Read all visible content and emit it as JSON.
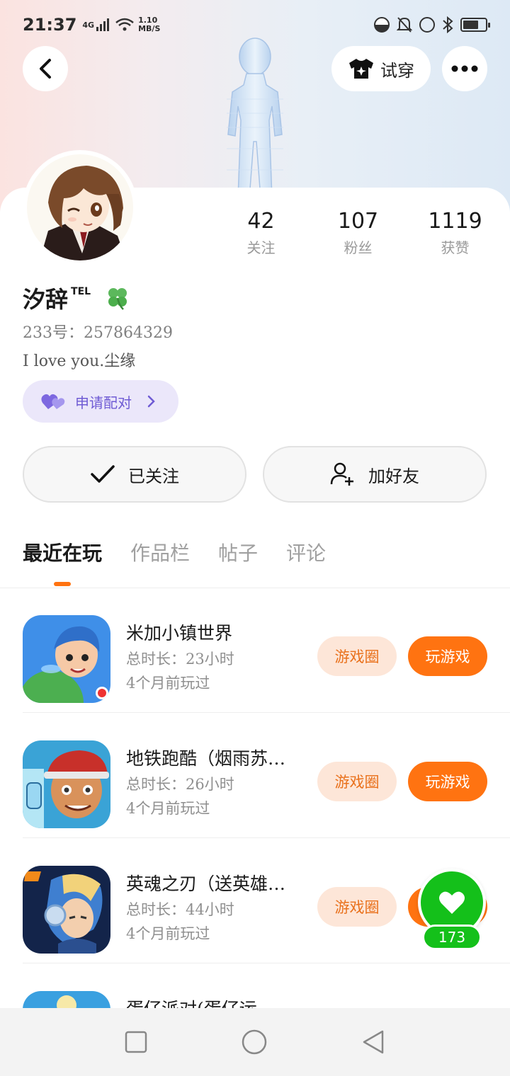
{
  "status_bar": {
    "time": "21:37",
    "network": "4G",
    "speed_value": "1.10",
    "speed_unit": "MB/S"
  },
  "header": {
    "back_icon": "chevron-left-icon",
    "tryon_label": "试穿",
    "tryon_icon": "tshirt-icon",
    "more_icon": "more-dots-icon"
  },
  "profile": {
    "name": "汐辞",
    "name_suffix": "TEL",
    "badge_icon": "clover-icon",
    "uid_text": "233号：257864329",
    "bio": "I love you.尘缘",
    "pair_label": "申请配对",
    "stats": [
      {
        "value": "42",
        "label": "关注"
      },
      {
        "value": "107",
        "label": "粉丝"
      },
      {
        "value": "1119",
        "label": "获赞"
      }
    ]
  },
  "actions": {
    "follow_label": "已关注",
    "add_friend_label": "加好友"
  },
  "tabs": [
    {
      "label": "最近在玩",
      "active": true
    },
    {
      "label": "作品栏",
      "active": false
    },
    {
      "label": "帖子",
      "active": false
    },
    {
      "label": "评论",
      "active": false
    }
  ],
  "games": [
    {
      "title": "米加小镇世界",
      "duration": "总时长：23小时",
      "last_played": "4个月前玩过",
      "circle_label": "游戏圈",
      "play_label": "玩游戏"
    },
    {
      "title": "地铁跑酷（烟雨苏…",
      "duration": "总时长：26小时",
      "last_played": "4个月前玩过",
      "circle_label": "游戏圈",
      "play_label": "玩游戏"
    },
    {
      "title": "英魂之刃（送英雄…",
      "duration": "总时长：44小时",
      "last_played": "4个月前玩过",
      "circle_label": "游戏圈",
      "play_label": "玩游戏"
    },
    {
      "title": "蛋仔派对(蛋仔运…",
      "duration": "",
      "last_played": "",
      "circle_label": "",
      "play_label": ""
    }
  ],
  "like_button": {
    "count": "173",
    "icon": "heart-icon"
  },
  "colors": {
    "accent": "#ff7311",
    "accent_soft": "#fde6d8",
    "pair_purple": "#6f5bd4",
    "like_green": "#14c01a"
  }
}
